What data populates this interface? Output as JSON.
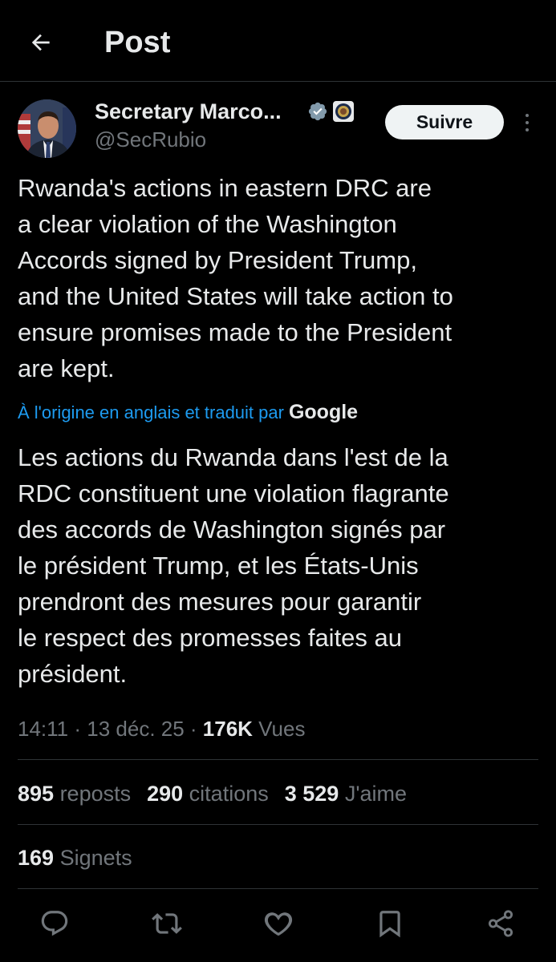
{
  "header": {
    "title": "Post"
  },
  "author": {
    "name": "Secretary Marco...",
    "handle": "@SecRubio",
    "follow_label": "Suivre"
  },
  "post": {
    "lines": [
      "Rwanda's actions in eastern DRC are",
      "a clear violation of the Washington",
      "Accords signed by President Trump,",
      "and the United States will take action to",
      "ensure promises made to the President",
      "are kept."
    ],
    "translation_note": "À l'origine en anglais et traduit par",
    "translation_provider": "Google",
    "translated_lines": [
      "Les actions du Rwanda dans l'est de la",
      "RDC constituent une violation flagrante",
      "des accords de Washington signés par",
      "le président Trump, et les États-Unis",
      "prendront des mesures pour garantir",
      "le respect des promesses faites au",
      "président."
    ]
  },
  "meta": {
    "time": "14:11",
    "sep1": " · ",
    "date": "13 déc. 25",
    "sep2": " · ",
    "views_count": "176K",
    "views_label": " Vues"
  },
  "stats": {
    "reposts_count": "895",
    "reposts_label": " reposts",
    "quotes_count": "290",
    "quotes_label": " citations",
    "likes_count": "3 529",
    "likes_label": " J'aime",
    "bookmarks_count": "169",
    "bookmarks_label": " Signets"
  },
  "actions": [
    "reply-icon",
    "repost-icon",
    "like-icon",
    "bookmark-icon",
    "share-icon"
  ],
  "colors": {
    "background": "#000000",
    "text": "#e7e9ea",
    "muted": "#71767b",
    "link": "#1d9bf0",
    "verified": "#829aab"
  }
}
